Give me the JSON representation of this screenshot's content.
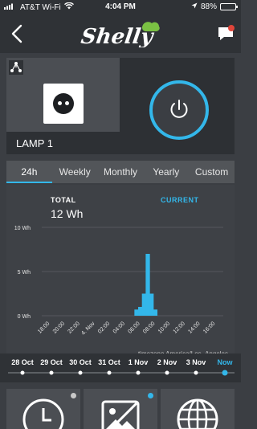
{
  "status_bar": {
    "carrier": "AT&T Wi-Fi",
    "time": "4:04 PM",
    "battery": "88%",
    "battery_level": 0.88
  },
  "header": {
    "logo_text": "Shelly",
    "icons": [
      "back-chevron-icon",
      "chat-icon"
    ]
  },
  "device": {
    "name": "LAMP 1",
    "icons": [
      "share-icon",
      "plug-icon",
      "power-icon"
    ],
    "power_ring_color": "#33b7ea"
  },
  "tabs": [
    {
      "label": "24h",
      "active": true
    },
    {
      "label": "Weekly",
      "active": false
    },
    {
      "label": "Monthly",
      "active": false
    },
    {
      "label": "Yearly",
      "active": false
    },
    {
      "label": "Custom",
      "active": false
    }
  ],
  "chart": {
    "total_label": "TOTAL",
    "total_value": "12 Wh",
    "current_label": "CURRENT",
    "timezone_label": "timezone America/Los_Angeles"
  },
  "chart_data": {
    "type": "bar",
    "ylim": [
      0,
      10
    ],
    "y_ticks": [
      "10 Wh",
      "5 Wh",
      "0 Wh"
    ],
    "y_tick_values": [
      10,
      5,
      0
    ],
    "categories": [
      "18:00",
      "20:00",
      "22:00",
      "4. Nov",
      "02:00",
      "04:00",
      "06:00",
      "08:00",
      "10:00",
      "12:00",
      "14:00",
      "16:00"
    ],
    "bars": [
      {
        "x": 11.5,
        "value": 0.7
      },
      {
        "x": 12.0,
        "value": 1.0
      },
      {
        "x": 12.5,
        "value": 2.5
      },
      {
        "x": 13.0,
        "value": 7.0
      },
      {
        "x": 13.5,
        "value": 2.5
      },
      {
        "x": 14.0,
        "value": 0.7
      }
    ],
    "x_unit": "hour since 18:00 (category index * 2)",
    "bar_color": "#33b7ea",
    "grid": true
  },
  "timeline": {
    "dates": [
      "28 Oct",
      "29 Oct",
      "30 Oct",
      "31 Oct",
      "1 Nov",
      "2 Nov",
      "3 Nov",
      "Now"
    ],
    "active_index": 7,
    "accent": "#33b7ea"
  },
  "tiles": [
    {
      "icon": "clock-icon",
      "dot_color": "#c8c8c8"
    },
    {
      "icon": "no-image-icon",
      "dot_color": "#33b7ea"
    },
    {
      "icon": "globe-icon",
      "dot_color": ""
    }
  ]
}
